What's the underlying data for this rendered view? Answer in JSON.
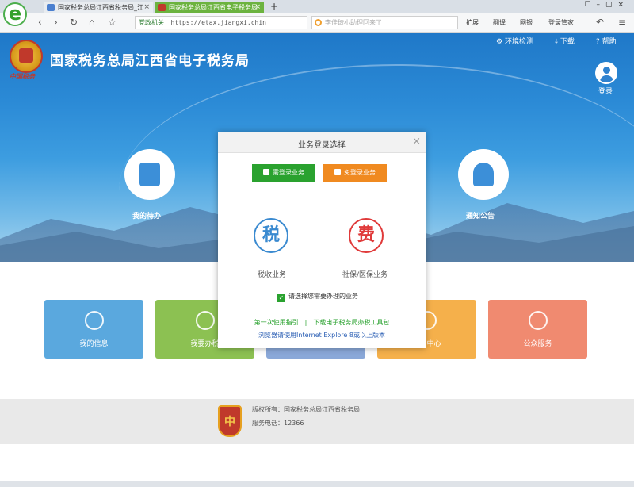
{
  "browser": {
    "tabs": [
      {
        "label": "国家税务总局江西省税务局_江"
      },
      {
        "label": "国家税务总局江西省电子税务局"
      }
    ],
    "new_tab": "+",
    "address_badge": "党政机关",
    "url": "https://etax.jiangxi.chin",
    "search_placeholder": "李佳琦小助理回来了",
    "toolbar_items": [
      "扩展",
      "翻译",
      "网银",
      "登录管家"
    ]
  },
  "site": {
    "seal_text": "中国税务",
    "title": "国家税务总局江西省电子税务局",
    "header_links": [
      "环境检测",
      "下载",
      "帮助"
    ],
    "login_label": "登录"
  },
  "hero_items": [
    {
      "label": "我的待办"
    },
    {
      "label": "通知公告"
    }
  ],
  "cards": [
    {
      "label": "我的信息",
      "color": "#5aa8de"
    },
    {
      "label": "我要办税",
      "color": "#8cc152"
    },
    {
      "label": "",
      "color": "#8aa8d8"
    },
    {
      "label": "互动中心",
      "color": "#f5b04b"
    },
    {
      "label": "公众服务",
      "color": "#f08a70"
    }
  ],
  "footer": {
    "logo_char": "中",
    "copyright": "版权所有：国家税务总局江西省税务局",
    "phone": "服务电话：12366"
  },
  "dialog": {
    "title": "业务登录选择",
    "close": "×",
    "btn_login": "需登录业务",
    "btn_free": "免登录业务",
    "tax_glyph": "税",
    "tax_label": "税收业务",
    "social_glyph": "费",
    "social_label": "社保/医保业务",
    "check_label": "请选择您需要办理的业务",
    "link_guide": "第一次使用指引",
    "link_sep": "|",
    "link_tool": "下载电子税务局办税工具包",
    "browser_note": "浏览器请使用Internet Explore 8或以上版本"
  },
  "colors": {
    "accent_green": "#2aa22f",
    "accent_orange": "#f08a20",
    "tax_blue": "#3a8ad0",
    "social_red": "#e03a3a"
  }
}
